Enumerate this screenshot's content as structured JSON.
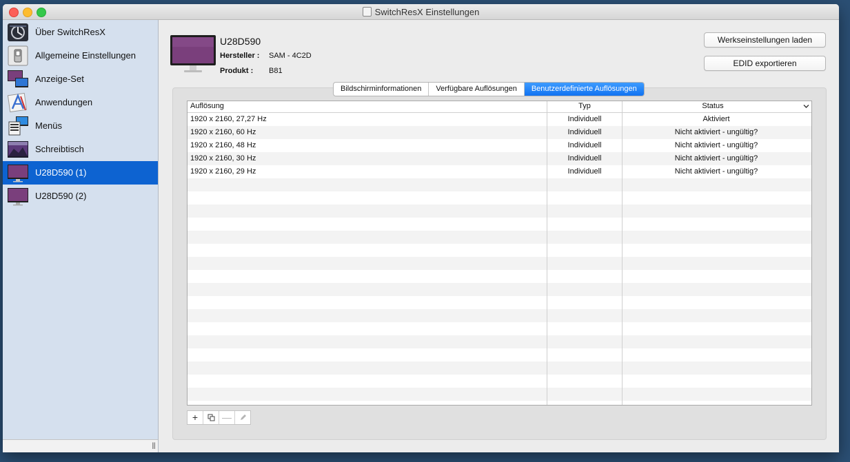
{
  "window": {
    "title": "SwitchResX Einstellungen"
  },
  "sidebar": {
    "items": [
      {
        "label": "Über SwitchResX",
        "icon": "switchresx-logo-icon"
      },
      {
        "label": "Allgemeine Einstellungen",
        "icon": "switch-settings-icon"
      },
      {
        "label": "Anzeige-Set",
        "icon": "display-set-icon"
      },
      {
        "label": "Anwendungen",
        "icon": "applications-icon"
      },
      {
        "label": "Menüs",
        "icon": "menus-icon"
      },
      {
        "label": "Schreibtisch",
        "icon": "desktop-icon"
      },
      {
        "label": "U28D590 (1)",
        "icon": "monitor-icon",
        "selected": true
      },
      {
        "label": "U28D590 (2)",
        "icon": "monitor-icon"
      }
    ]
  },
  "display": {
    "name": "U28D590",
    "manufacturer_label": "Hersteller :",
    "manufacturer_value": "SAM - 4C2D",
    "product_label": "Produkt :",
    "product_value": "B81"
  },
  "buttons": {
    "factory_defaults": "Werkseinstellungen laden",
    "export_edid": "EDID exportieren"
  },
  "tabs": [
    {
      "label": "Bildschirminformationen",
      "active": false
    },
    {
      "label": "Verfügbare Auflösungen",
      "active": false
    },
    {
      "label": "Benutzerdefinierte Auflösungen",
      "active": true
    }
  ],
  "table": {
    "headers": {
      "resolution": "Auflösung",
      "type": "Typ",
      "status": "Status"
    },
    "rows": [
      {
        "resolution": "1920 x 2160, 27,27 Hz",
        "type": "Individuell",
        "status": "Aktiviert"
      },
      {
        "resolution": "1920 x 2160, 60 Hz",
        "type": "Individuell",
        "status": "Nicht aktiviert - ungültig?"
      },
      {
        "resolution": "1920 x 2160, 48 Hz",
        "type": "Individuell",
        "status": "Nicht aktiviert - ungültig?"
      },
      {
        "resolution": "1920 x 2160, 30 Hz",
        "type": "Individuell",
        "status": "Nicht aktiviert - ungültig?"
      },
      {
        "resolution": "1920 x 2160, 29 Hz",
        "type": "Individuell",
        "status": "Nicht aktiviert - ungültig?"
      }
    ]
  },
  "toolbar": {
    "add": "+",
    "duplicate_icon": "duplicate-icon",
    "remove": "—",
    "edit_icon": "pencil-icon"
  },
  "colors": {
    "selection": "#0d63d1",
    "sidebar_bg": "#d5e0ee",
    "tab_active": "#1173f1",
    "monitor_screen": "#7a3f7c"
  }
}
